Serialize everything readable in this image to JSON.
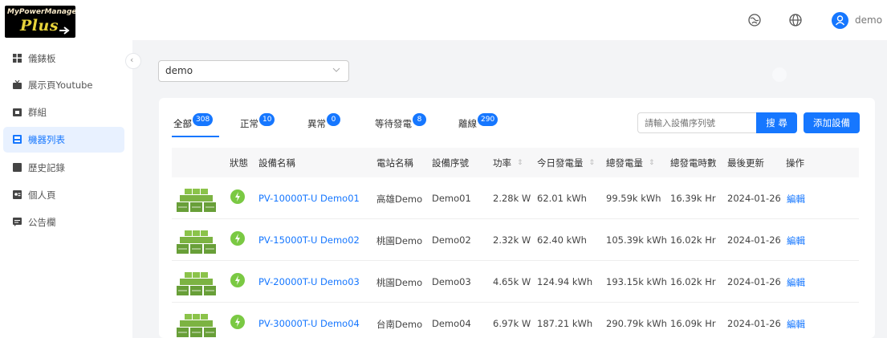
{
  "header": {
    "logo_line1": "MyPowerManager",
    "logo_line2": "Plus",
    "logo_line3": "...",
    "user": "demo"
  },
  "sidebar": {
    "items": [
      {
        "label": "儀錶板",
        "icon": "dashboard-icon",
        "active": false
      },
      {
        "label": "展示頁Youtube",
        "icon": "youtube-icon",
        "active": false
      },
      {
        "label": "群組",
        "icon": "group-icon",
        "active": false
      },
      {
        "label": "機器列表",
        "icon": "device-list-icon",
        "active": true
      },
      {
        "label": "歷史記錄",
        "icon": "history-icon",
        "active": false
      },
      {
        "label": "個人頁",
        "icon": "profile-icon",
        "active": false
      },
      {
        "label": "公告欄",
        "icon": "announcement-icon",
        "active": false
      }
    ]
  },
  "filter": {
    "selected": "demo"
  },
  "tabs": [
    {
      "label": "全部",
      "count": "308"
    },
    {
      "label": "正常",
      "count": "10"
    },
    {
      "label": "異常",
      "count": "0"
    },
    {
      "label": "等待發電",
      "count": "8"
    },
    {
      "label": "離線",
      "count": "290"
    }
  ],
  "search": {
    "placeholder": "請輸入設備序列號",
    "button": "搜 尋"
  },
  "add_button": "添加設備",
  "table": {
    "columns": [
      "狀態",
      "設備名稱",
      "電站名稱",
      "設備序號",
      "功率",
      "今日發電量",
      "總發電量",
      "總發電時數",
      "最後更新",
      "操作"
    ],
    "rows": [
      {
        "name": "PV-10000T-U Demo01",
        "station": "高雄Demo",
        "serial": "Demo01",
        "power": "2.28k W",
        "today": "62.01 kWh",
        "total": "99.59k kWh",
        "hours": "16.39k Hr",
        "updated": "2024-01-26",
        "action": "編輯"
      },
      {
        "name": "PV-15000T-U Demo02",
        "station": "桃園Demo",
        "serial": "Demo02",
        "power": "2.32k W",
        "today": "62.40 kWh",
        "total": "105.39k kWh",
        "hours": "16.02k Hr",
        "updated": "2024-01-26",
        "action": "編輯"
      },
      {
        "name": "PV-20000T-U Demo03",
        "station": "桃園Demo",
        "serial": "Demo03",
        "power": "4.65k W",
        "today": "124.94 kWh",
        "total": "193.15k kWh",
        "hours": "16.02k Hr",
        "updated": "2024-01-26",
        "action": "編輯"
      },
      {
        "name": "PV-30000T-U Demo04",
        "station": "台南Demo",
        "serial": "Demo04",
        "power": "6.97k W",
        "today": "187.21 kWh",
        "total": "290.79k kWh",
        "hours": "16.09k Hr",
        "updated": "2024-01-26",
        "action": "編輯"
      }
    ]
  },
  "colors": {
    "accent": "#1677ff",
    "status_green": "#7ac943",
    "panel_green": "#8bc34a"
  }
}
